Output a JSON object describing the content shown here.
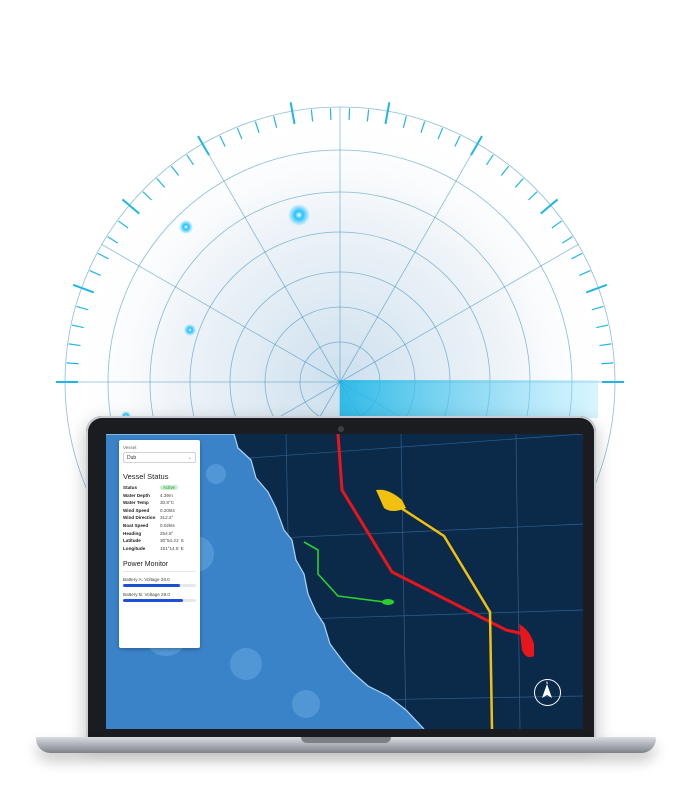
{
  "panel": {
    "vessel_label": "Vessel:",
    "vessel_selected": "Dub",
    "status_title": "Vessel Status",
    "rows": [
      {
        "key": "Status",
        "value": "Active",
        "badge": true
      },
      {
        "key": "Water Depth",
        "value": "4.39m"
      },
      {
        "key": "Water Temp",
        "value": "30.8°C"
      },
      {
        "key": "Wind Speed",
        "value": "0.20kts"
      },
      {
        "key": "Wind Direction",
        "value": "312.2°"
      },
      {
        "key": "Boat Speed",
        "value": "0.02kts"
      },
      {
        "key": "Heading",
        "value": "254.8°"
      },
      {
        "key": "Latitude",
        "value": "30°54.21' S"
      },
      {
        "key": "Longitude",
        "value": "151°14.5' E"
      }
    ],
    "power_title": "Power Monitor",
    "batteries": [
      {
        "label": "Battery A: Voltage 28.0",
        "level": 0.78
      },
      {
        "label": "Battery B: Voltage 29.0",
        "level": 0.82
      }
    ]
  },
  "map": {
    "compass_label": "N",
    "colors": {
      "ocean": "#0b2a4a",
      "land": "#3b83c9",
      "route_red": "#e8151b",
      "route_yellow": "#f2c10f",
      "route_green": "#27d22a"
    }
  },
  "radar": {
    "accent": "#1fb6e6"
  }
}
